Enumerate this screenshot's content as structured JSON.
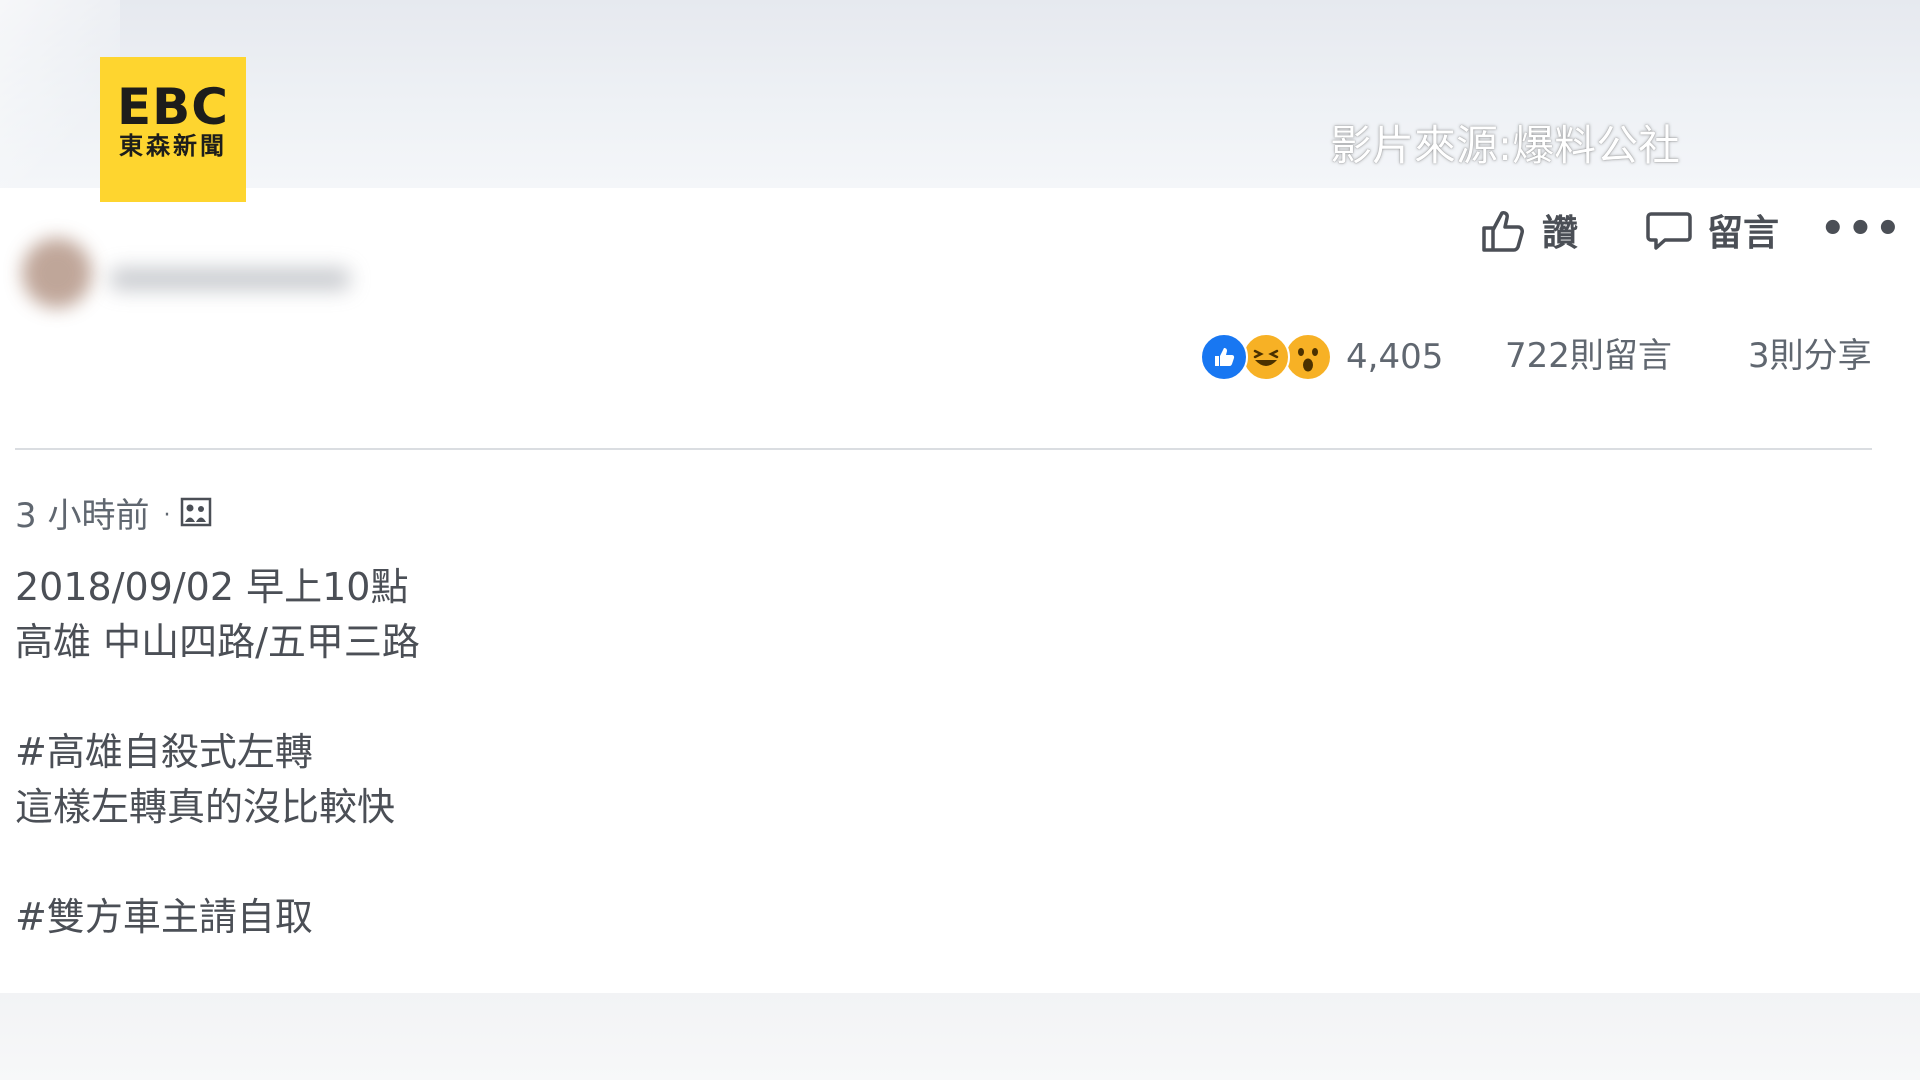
{
  "logo": {
    "mark": "EBC",
    "sub": "東森新聞"
  },
  "watermark": "影片來源:爆料公社",
  "actions": {
    "like_label": "讚",
    "comment_label": "留言",
    "more_label": "•••"
  },
  "reactions": {
    "count": "4,405",
    "types": [
      "like-icon",
      "haha-icon",
      "wow-icon"
    ]
  },
  "stats": {
    "comments": "722則留言",
    "shares": "3則分享"
  },
  "post": {
    "time": "3 小時前",
    "separator": "·",
    "lines": [
      "2018/09/02 早上10點",
      "高雄 中山四路/五甲三路",
      "",
      "#高雄自殺式左轉",
      "這樣左轉真的沒比較快",
      "",
      "#雙方車主請自取"
    ]
  },
  "colors": {
    "logo_yellow": "#fed52f",
    "like_blue": "#1877f2",
    "reaction_yellow": "#f7b125",
    "text": "#4b4f56"
  }
}
